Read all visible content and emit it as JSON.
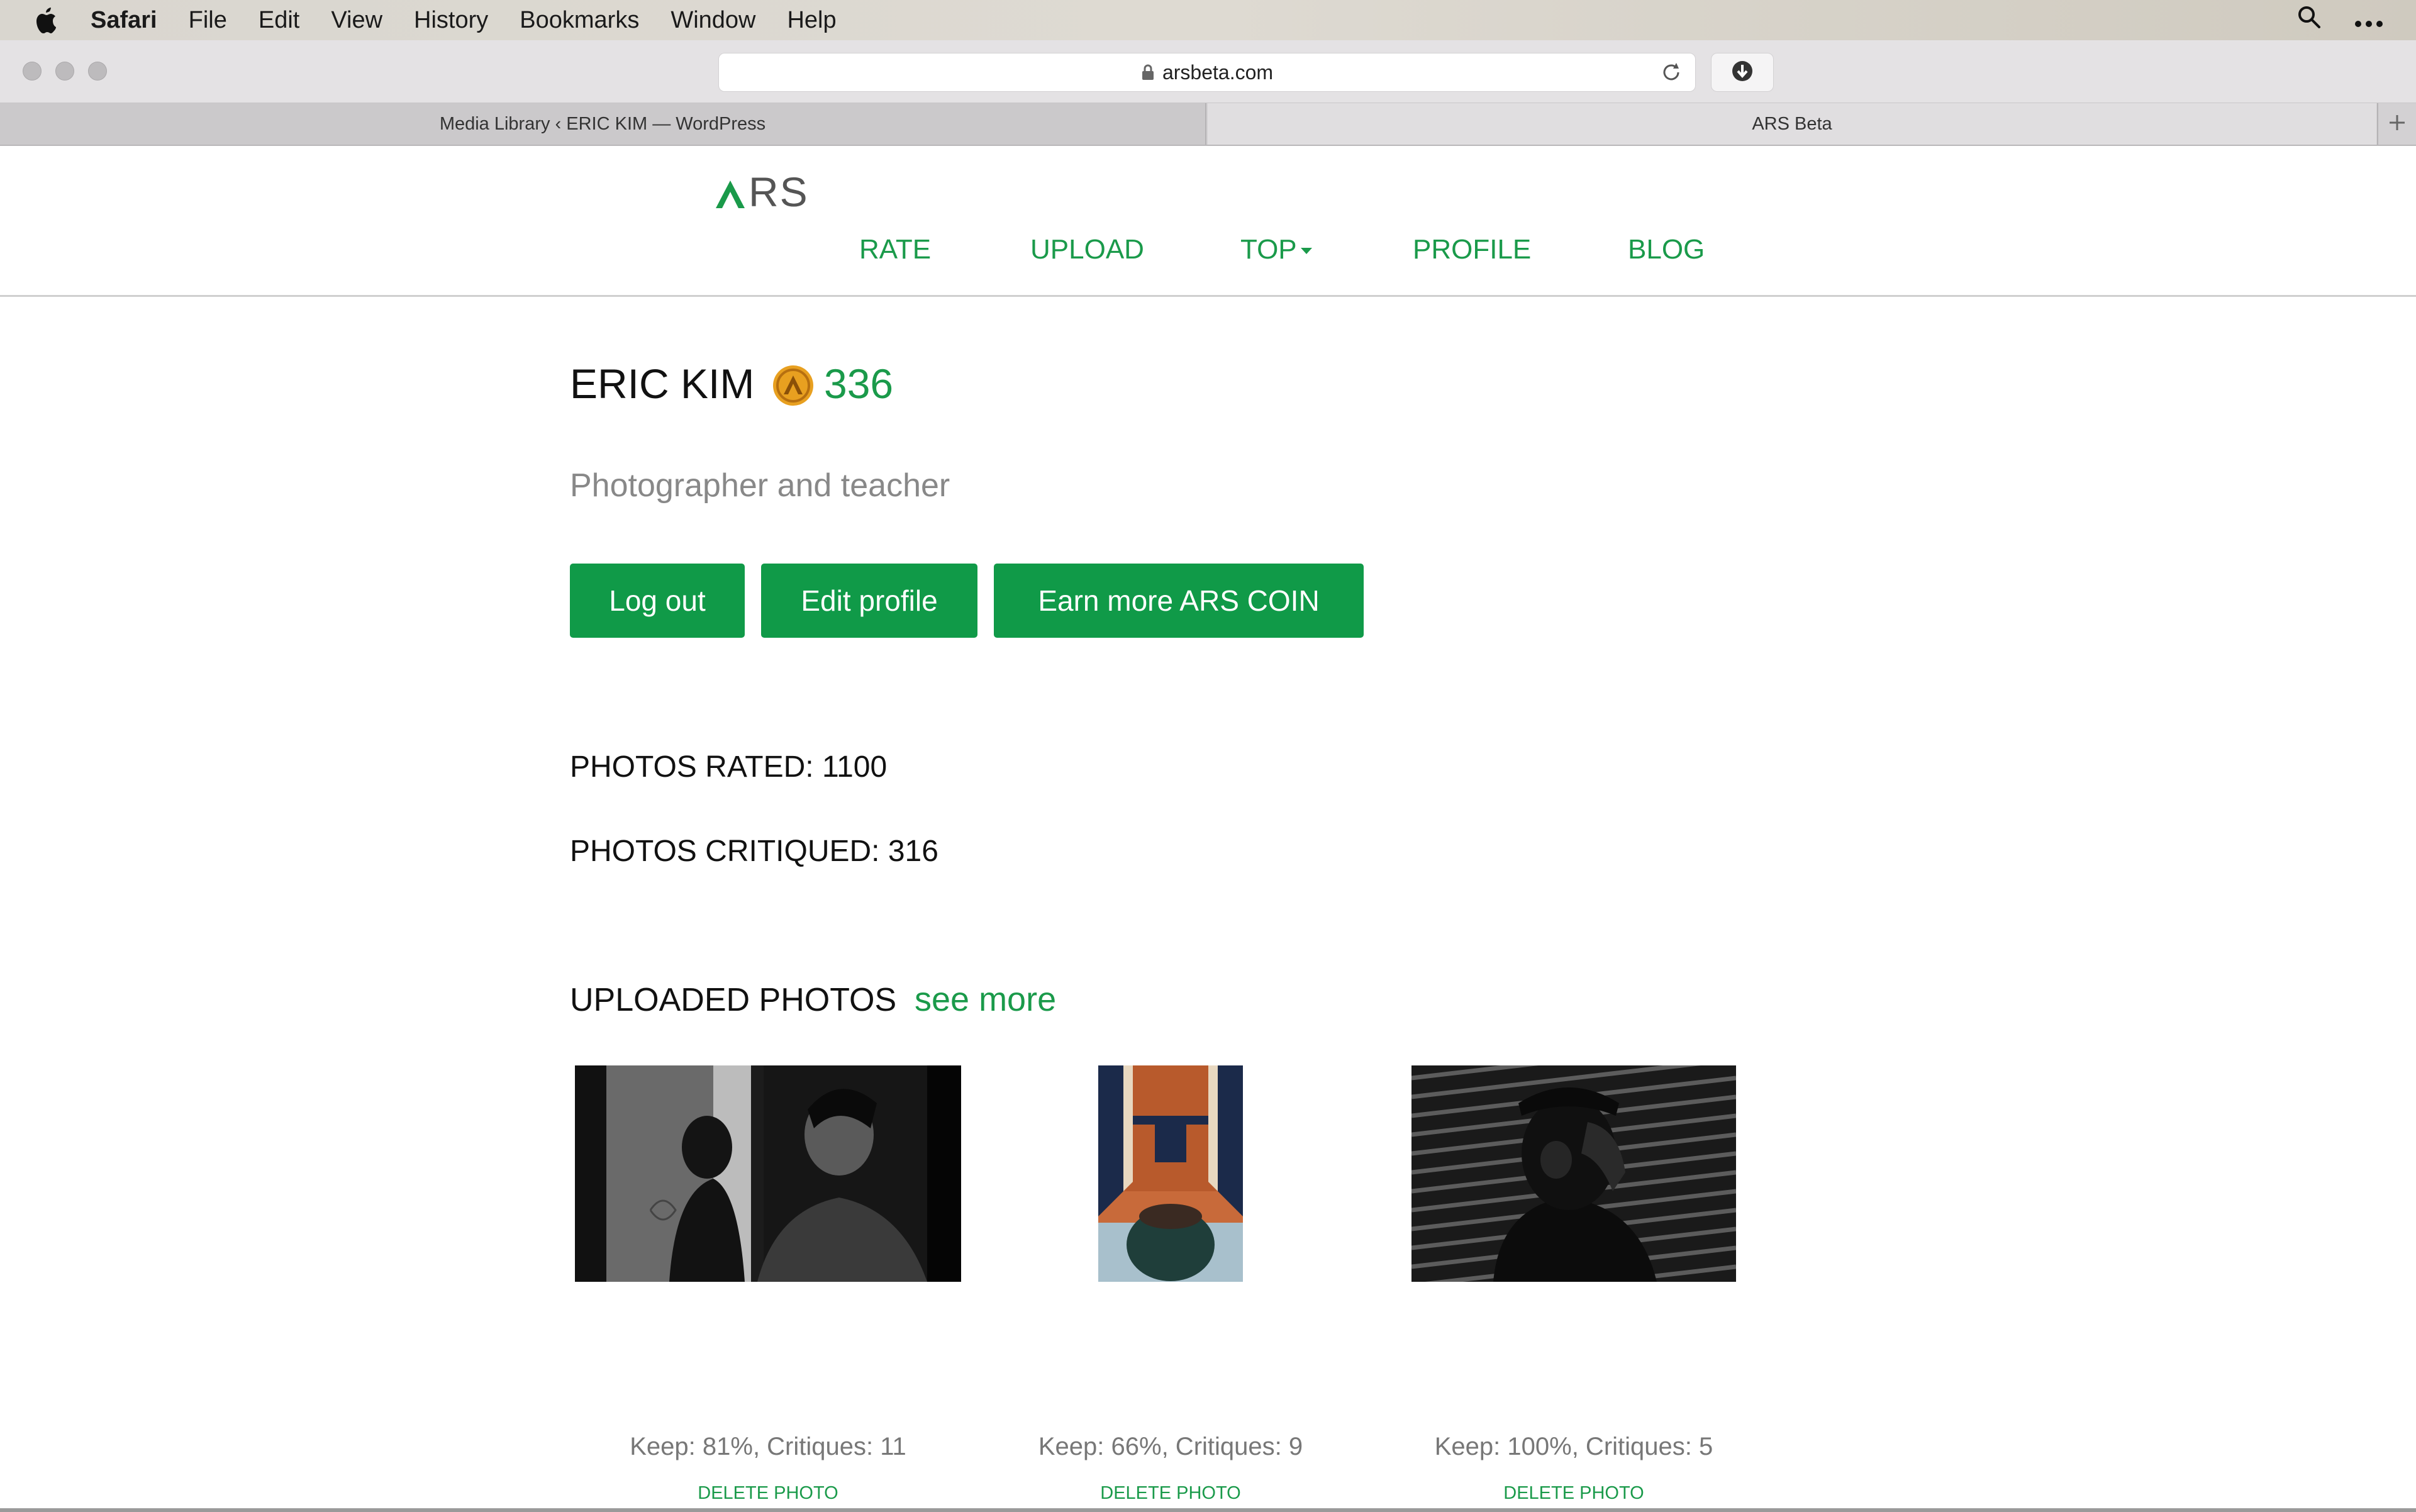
{
  "menubar": {
    "app_name": "Safari",
    "items": [
      "File",
      "Edit",
      "View",
      "History",
      "Bookmarks",
      "Window",
      "Help"
    ]
  },
  "browser": {
    "url": "arsbeta.com",
    "tabs": [
      {
        "label": "Media Library ‹ ERIC KIM — WordPress",
        "active": false
      },
      {
        "label": "ARS Beta",
        "active": true
      }
    ]
  },
  "site": {
    "logo_text": "RS",
    "nav": {
      "rate": "RATE",
      "upload": "UPLOAD",
      "top": "TOP",
      "profile": "PROFILE",
      "blog": "BLOG"
    },
    "accent_color": "#1a9a4a"
  },
  "profile": {
    "name": "ERIC KIM",
    "coins": "336",
    "bio": "Photographer and teacher",
    "buttons": {
      "logout": "Log out",
      "edit": "Edit profile",
      "earn": "Earn more ARS COIN"
    },
    "stats": {
      "rated": "PHOTOS RATED: 1100",
      "critiqued": "PHOTOS CRITIQUED: 316"
    }
  },
  "uploaded": {
    "heading": "UPLOADED PHOTOS",
    "see_more": "see more",
    "photos": [
      {
        "caption": "Keep: 81%, Critiques: 11",
        "delete": "DELETE PHOTO"
      },
      {
        "caption": "Keep: 66%, Critiques: 9",
        "delete": "DELETE PHOTO"
      },
      {
        "caption": "Keep: 100%, Critiques: 5",
        "delete": "DELETE PHOTO"
      }
    ]
  }
}
